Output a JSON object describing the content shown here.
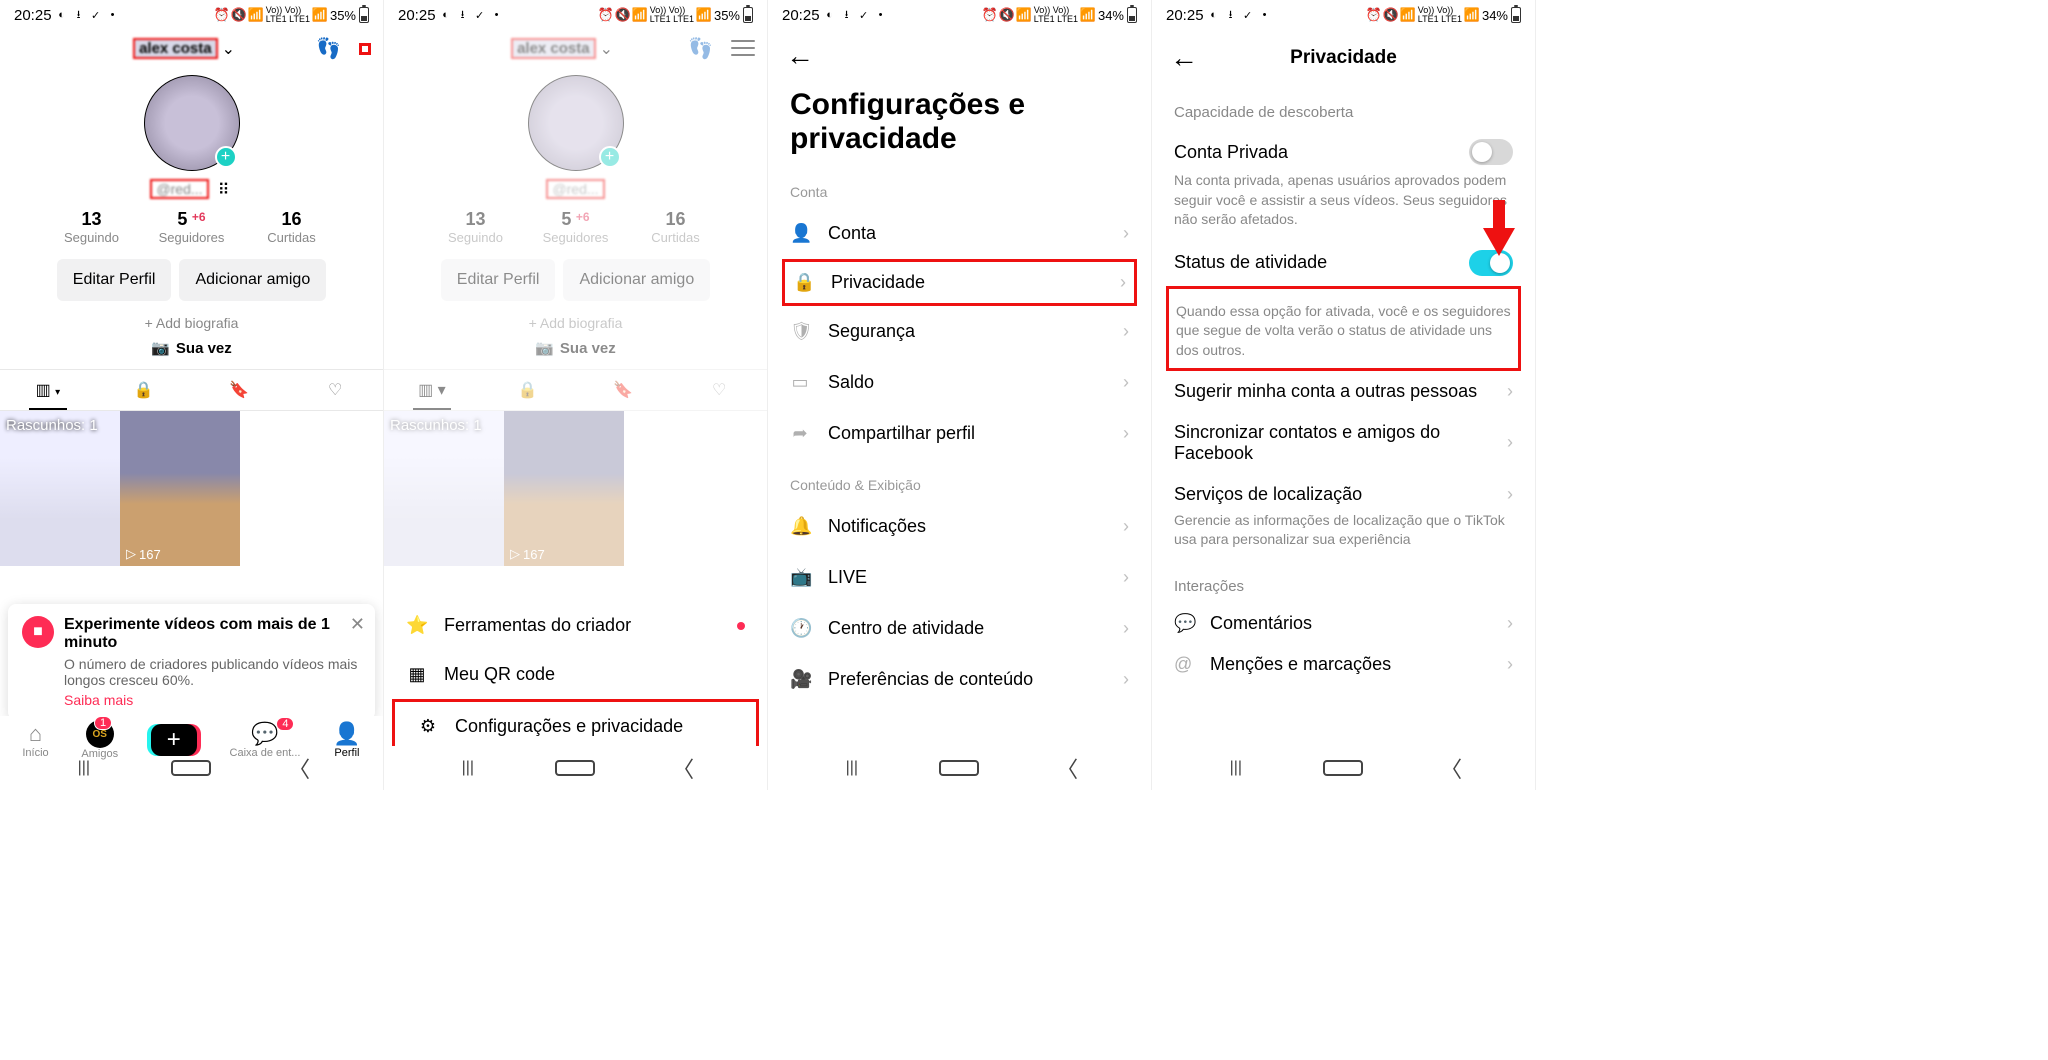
{
  "status": {
    "time": "20:25",
    "battery1": "35%",
    "battery2": "34%",
    "net": "Vo)) Vo))\nLTE1 LTE1"
  },
  "profile": {
    "name": "alex costa",
    "handle": "@red...",
    "stats": {
      "following_n": "13",
      "following_l": "Seguindo",
      "followers_n": "5",
      "followers_l": "Seguidores",
      "followers_plus": "+6",
      "likes_n": "16",
      "likes_l": "Curtidas"
    },
    "edit_btn": "Editar Perfil",
    "add_friend_btn": "Adicionar amigo",
    "add_bio": "+ Add biografia",
    "sua_vez": "Sua vez",
    "drafts": "Rascunhos: 1",
    "views": "167"
  },
  "promo": {
    "title": "Experimente vídeos com mais de 1 minuto",
    "body": "O número de criadores publicando vídeos mais longos cresceu 60%.",
    "more": "Saiba mais"
  },
  "nav": {
    "home": "Início",
    "friends": "Amigos",
    "inbox": "Caixa de ent...",
    "profile": "Perfil",
    "badge_friends": "1",
    "badge_inbox": "4"
  },
  "sheet": {
    "creator": "Ferramentas do criador",
    "qr": "Meu QR code",
    "settings": "Configurações e privacidade"
  },
  "settings": {
    "title": "Configurações e privacidade",
    "sect_account": "Conta",
    "account": "Conta",
    "privacy": "Privacidade",
    "security": "Segurança",
    "balance": "Saldo",
    "share": "Compartilhar perfil",
    "sect_content": "Conteúdo & Exibição",
    "notif": "Notificações",
    "live": "LIVE",
    "activity": "Centro de atividade",
    "prefs": "Preferências de conteúdo"
  },
  "privacy": {
    "title": "Privacidade",
    "sect_disc": "Capacidade de descoberta",
    "private_acc": "Conta Privada",
    "private_desc": "Na conta privada, apenas usuários aprovados podem seguir você e assistir a seus vídeos. Seus seguidores não serão afetados.",
    "activity_status": "Status de atividade",
    "activity_desc": "Quando essa opção for ativada, você e os seguidores que segue de volta verão o status de atividade uns dos outros.",
    "suggest": "Sugerir minha conta a outras pessoas",
    "sync": "Sincronizar contatos e amigos do Facebook",
    "location": "Serviços de localização",
    "location_desc": "Gerencie as informações de localização que o TikTok usa para personalizar sua experiência",
    "sect_inter": "Interações",
    "comments": "Comentários",
    "mentions": "Menções e marcações"
  }
}
